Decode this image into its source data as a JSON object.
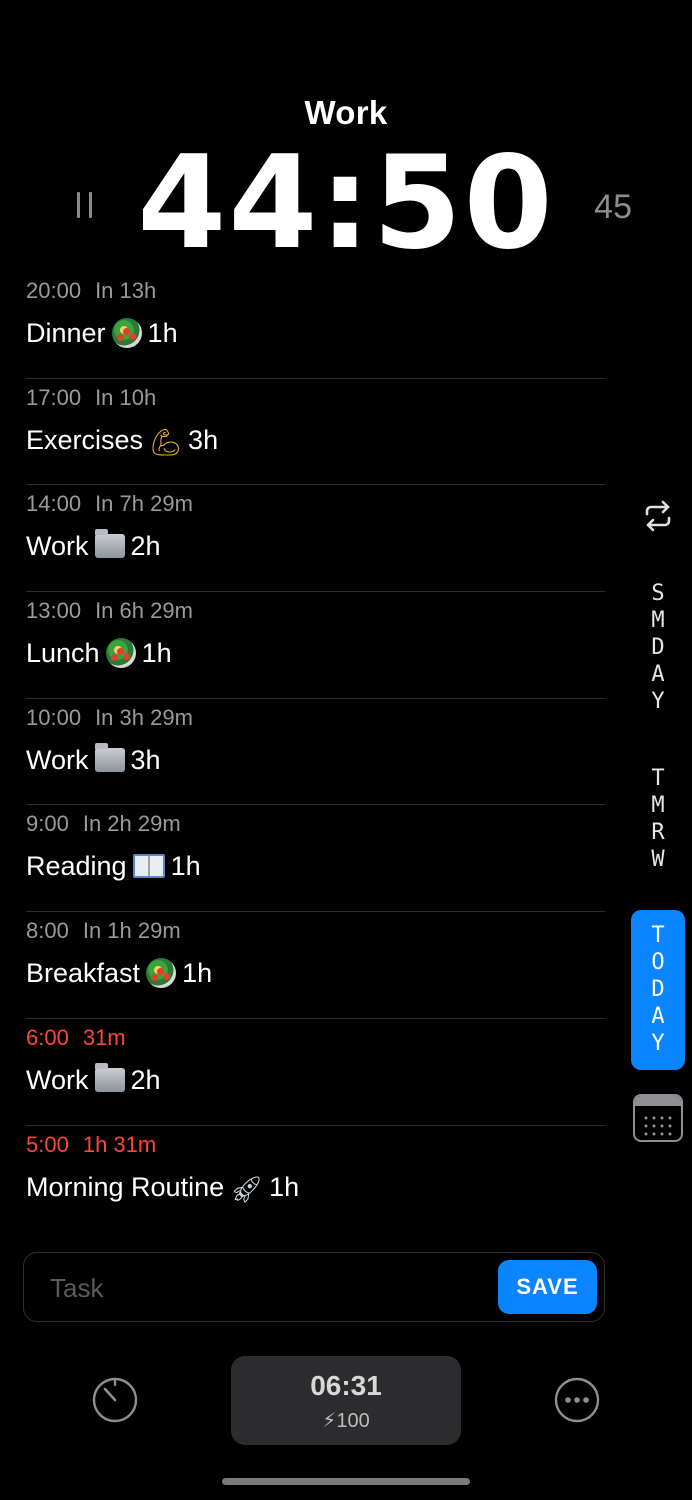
{
  "header": {
    "title": "Work",
    "timer": "44:50",
    "duration_right": "45"
  },
  "tasks": [
    {
      "time": "20:00",
      "relative": "In 13h",
      "name": "Dinner",
      "emoji": "salad",
      "duration": "1h",
      "overdue": false
    },
    {
      "time": "17:00",
      "relative": "In 10h",
      "name": "Exercises",
      "emoji": "arm",
      "duration": "3h",
      "overdue": false
    },
    {
      "time": "14:00",
      "relative": "In 7h 29m",
      "name": "Work",
      "emoji": "folder",
      "duration": "2h",
      "overdue": false
    },
    {
      "time": "13:00",
      "relative": "In 6h 29m",
      "name": "Lunch",
      "emoji": "salad",
      "duration": "1h",
      "overdue": false
    },
    {
      "time": "10:00",
      "relative": "In 3h 29m",
      "name": "Work",
      "emoji": "folder",
      "duration": "3h",
      "overdue": false
    },
    {
      "time": "9:00",
      "relative": "In 2h 29m",
      "name": "Reading",
      "emoji": "book",
      "duration": "1h",
      "overdue": false
    },
    {
      "time": "8:00",
      "relative": "In 1h 29m",
      "name": "Breakfast",
      "emoji": "salad",
      "duration": "1h",
      "overdue": false
    },
    {
      "time": "6:00",
      "relative": "31m",
      "name": "Work",
      "emoji": "folder",
      "duration": "2h",
      "overdue": true
    },
    {
      "time": "5:00",
      "relative": "1h 31m",
      "name": "Morning Routine",
      "emoji": "rocket",
      "duration": "1h",
      "overdue": true
    }
  ],
  "sidebar": {
    "someday_label": "SMDAY",
    "tomorrow_label": "TMRW",
    "today_label": "TODAY",
    "icons": [
      "repeat-icon",
      "calendar-icon"
    ]
  },
  "input": {
    "placeholder": "Task",
    "value": "",
    "save_label": "SAVE"
  },
  "bottom": {
    "clock": "06:31",
    "energy": "100",
    "icons": [
      "timer-icon",
      "bolt-icon",
      "more-icon"
    ]
  },
  "colors": {
    "accent": "#0a84ff",
    "overdue": "#ff453a",
    "background": "#000000"
  }
}
